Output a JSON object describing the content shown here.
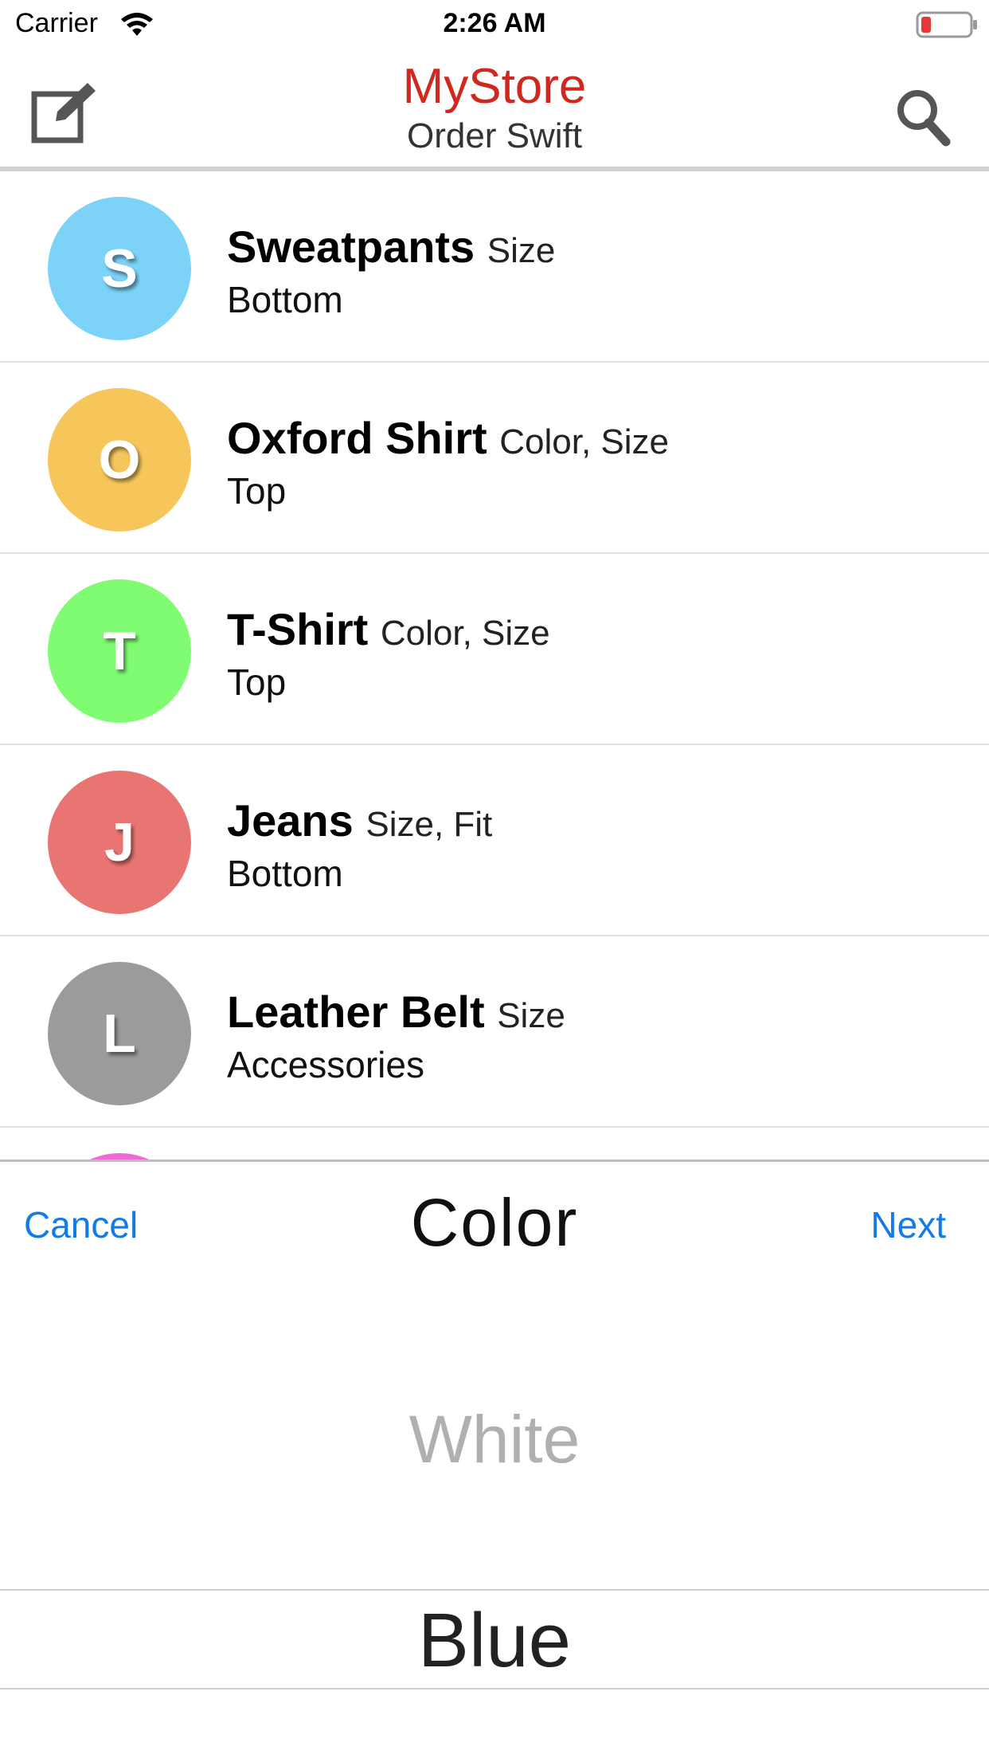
{
  "status_bar": {
    "carrier": "Carrier",
    "time": "2:26 AM",
    "battery_color": "#e53935"
  },
  "nav": {
    "title": "MyStore",
    "subtitle": "Order Swift",
    "title_color": "#d0281f",
    "left_icon": "compose-icon",
    "right_icon": "search-icon"
  },
  "products": [
    {
      "initial": "S",
      "name": "Sweatpants",
      "options": "Size",
      "category": "Bottom",
      "color": "#7dd3f7"
    },
    {
      "initial": "O",
      "name": "Oxford Shirt",
      "options": "Color, Size",
      "category": "Top",
      "color": "#f6c65b"
    },
    {
      "initial": "T",
      "name": "T-Shirt",
      "options": "Color, Size",
      "category": "Top",
      "color": "#80fc73"
    },
    {
      "initial": "J",
      "name": "Jeans",
      "options": "Size, Fit",
      "category": "Bottom",
      "color": "#e87571"
    },
    {
      "initial": "L",
      "name": "Leather Belt",
      "options": "Size",
      "category": "Accessories",
      "color": "#9b9b9b"
    }
  ],
  "partial_row_color": "#ef6ad6",
  "picker": {
    "cancel": "Cancel",
    "title": "Color",
    "next": "Next",
    "options": [
      "White",
      "Blue"
    ],
    "selected": "Blue",
    "action_color": "#127be8"
  }
}
